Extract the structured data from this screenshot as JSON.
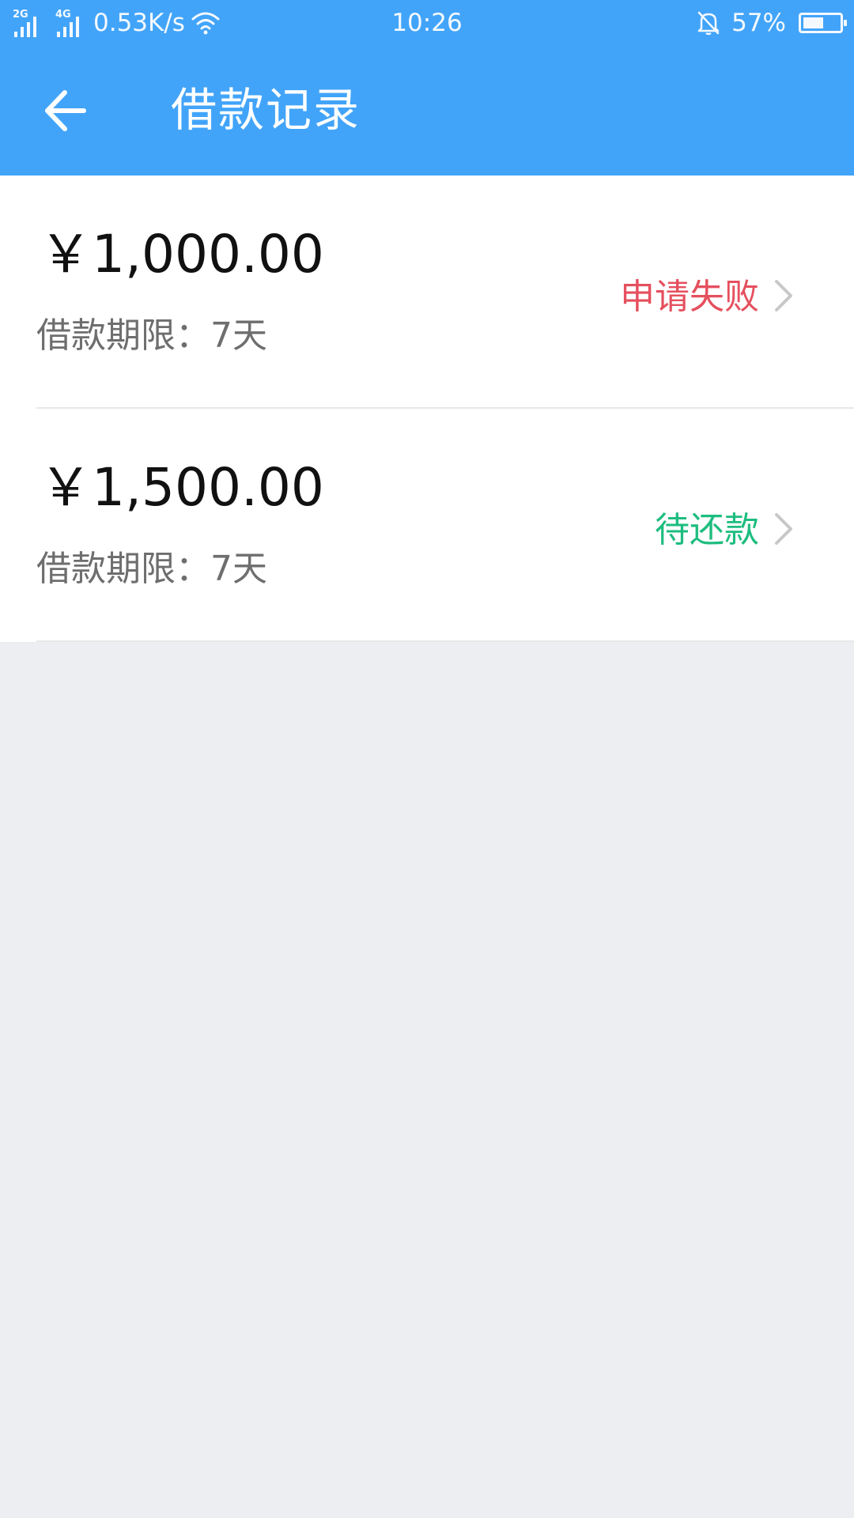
{
  "status_bar": {
    "signal1_label": "2G",
    "signal2_label": "4G",
    "net_speed": "0.53K/s",
    "time": "10:26",
    "battery_pct": "57%",
    "battery_level": 0.57
  },
  "header": {
    "title": "借款记录",
    "back_icon": "arrow-left-icon"
  },
  "records": [
    {
      "amount": "￥1,000.00",
      "term": "借款期限：7天",
      "status": "申请失败",
      "status_color": "#e5505e"
    },
    {
      "amount": "￥1,500.00",
      "term": "借款期限：7天",
      "status": "待还款",
      "status_color": "#1dbd7f"
    }
  ],
  "colors": {
    "header_bg": "#42a4f9",
    "page_bg": "#eceef2",
    "chevron": "#c8c8c8"
  }
}
